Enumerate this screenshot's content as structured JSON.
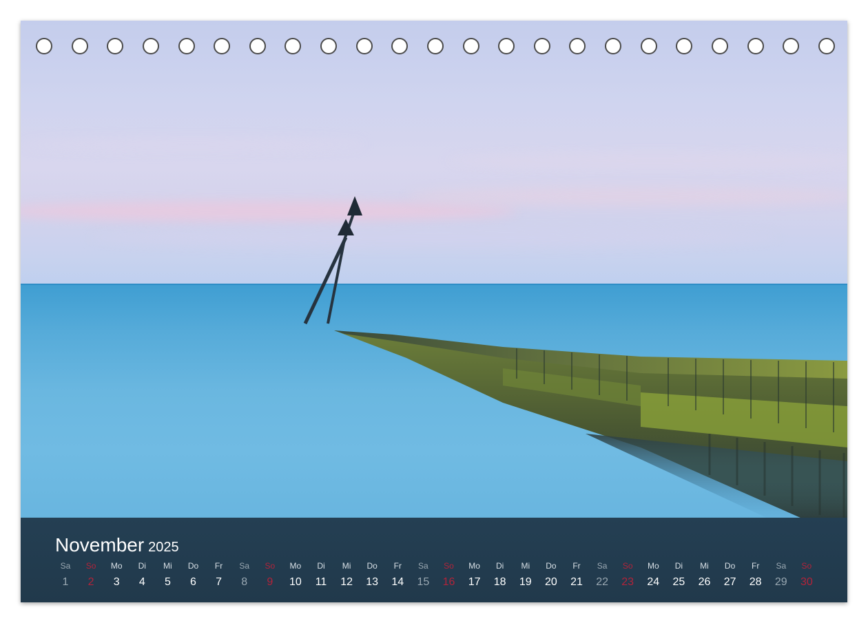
{
  "calendar": {
    "month": "November",
    "year": "2025",
    "ring_count": 23,
    "colors": {
      "banner": "#243f53",
      "weekday": "#ffffff",
      "saturday": "#9aa8b2",
      "sunday": "#b3233a"
    },
    "days": [
      {
        "wd": "Sa",
        "n": "1",
        "type": "sat"
      },
      {
        "wd": "So",
        "n": "2",
        "type": "sun"
      },
      {
        "wd": "Mo",
        "n": "3",
        "type": "week"
      },
      {
        "wd": "Di",
        "n": "4",
        "type": "week"
      },
      {
        "wd": "Mi",
        "n": "5",
        "type": "week"
      },
      {
        "wd": "Do",
        "n": "6",
        "type": "week"
      },
      {
        "wd": "Fr",
        "n": "7",
        "type": "week"
      },
      {
        "wd": "Sa",
        "n": "8",
        "type": "sat"
      },
      {
        "wd": "So",
        "n": "9",
        "type": "sun"
      },
      {
        "wd": "Mo",
        "n": "10",
        "type": "week"
      },
      {
        "wd": "Di",
        "n": "11",
        "type": "week"
      },
      {
        "wd": "Mi",
        "n": "12",
        "type": "week"
      },
      {
        "wd": "Do",
        "n": "13",
        "type": "week"
      },
      {
        "wd": "Fr",
        "n": "14",
        "type": "week"
      },
      {
        "wd": "Sa",
        "n": "15",
        "type": "sat"
      },
      {
        "wd": "So",
        "n": "16",
        "type": "sun"
      },
      {
        "wd": "Mo",
        "n": "17",
        "type": "week"
      },
      {
        "wd": "Di",
        "n": "18",
        "type": "week"
      },
      {
        "wd": "Mi",
        "n": "19",
        "type": "week"
      },
      {
        "wd": "Do",
        "n": "20",
        "type": "week"
      },
      {
        "wd": "Fr",
        "n": "21",
        "type": "week"
      },
      {
        "wd": "Sa",
        "n": "22",
        "type": "sat"
      },
      {
        "wd": "So",
        "n": "23",
        "type": "sun"
      },
      {
        "wd": "Mo",
        "n": "24",
        "type": "week"
      },
      {
        "wd": "Di",
        "n": "25",
        "type": "week"
      },
      {
        "wd": "Mi",
        "n": "26",
        "type": "week"
      },
      {
        "wd": "Do",
        "n": "27",
        "type": "week"
      },
      {
        "wd": "Fr",
        "n": "28",
        "type": "week"
      },
      {
        "wd": "Sa",
        "n": "29",
        "type": "sat"
      },
      {
        "wd": "So",
        "n": "30",
        "type": "sun"
      }
    ]
  },
  "photo": {
    "subject": "sea-groyne-with-beacon",
    "icon": "beacon-icon"
  }
}
